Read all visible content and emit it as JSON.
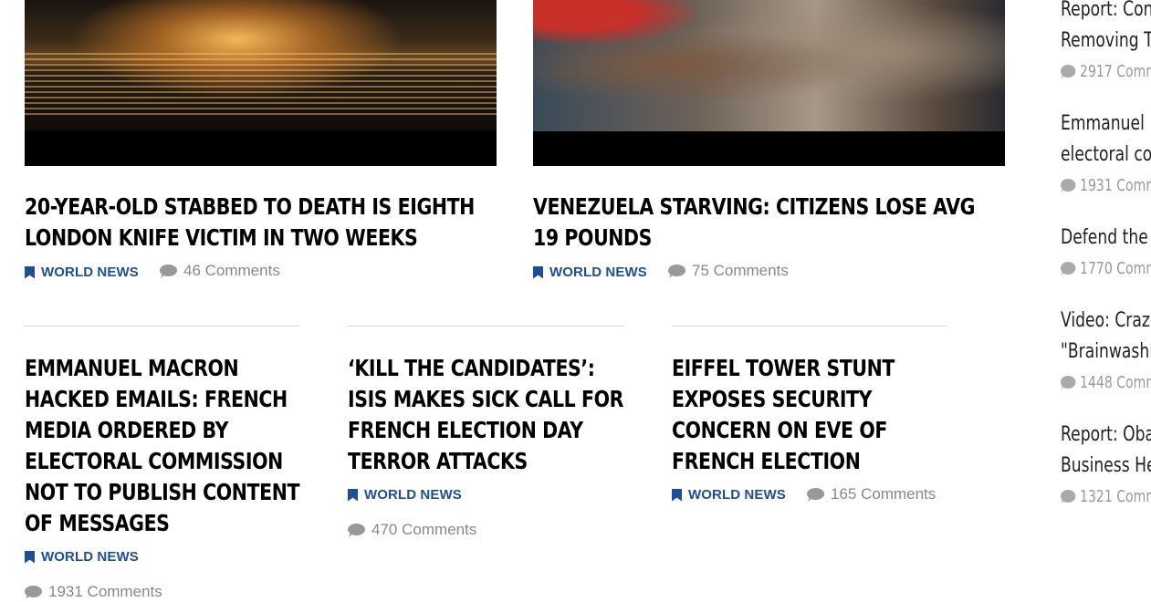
{
  "articles": [
    {
      "headline": "20-Year-Old Stabbed to Death Is Eighth London Knife Victim in Two Weeks",
      "category": "WORLD NEWS",
      "comments": "46 Comments"
    },
    {
      "headline": "Venezuela Starving: Citizens Lose Avg 19 Pounds",
      "category": "WORLD NEWS",
      "comments": "75 Comments"
    },
    {
      "headline": "Emmanuel Macron Hacked Emails: French Media Ordered by Electoral Commission Not to Publish Content of Messages",
      "category": "WORLD NEWS",
      "comments": "1931 Comments"
    },
    {
      "headline": "‘Kill the Candidates’: ISIS Makes Sick Call for French Election Day Terror Attacks",
      "category": "WORLD NEWS",
      "comments": "470 Comments"
    },
    {
      "headline": "Eiffel Tower Stunt Exposes Security Concern on Eve of French Election",
      "category": "WORLD NEWS",
      "comments": "165 Comments"
    }
  ],
  "sidebar": {
    "items": [
      {
        "title_line1": "Report: Con",
        "title_line2": "Removing Tr",
        "comments": "2917 Comm"
      },
      {
        "title_line1": "Emmanuel M",
        "title_line2": "electoral co",
        "comments": "1931 Comm"
      },
      {
        "title_line1": "Defend the V",
        "title_line2": "",
        "comments": "1770 Comm"
      },
      {
        "title_line1": "Video: Craze",
        "title_line2": "\"Brainwashi",
        "comments": "1448 Comm"
      },
      {
        "title_line1": "Report: Oba",
        "title_line2": "Business He",
        "comments": "1321 Comm"
      }
    ]
  },
  "colors": {
    "category": "#1f4e95",
    "comment_text": "#888888",
    "headline": "#000000"
  },
  "icons": {
    "category": "bookmark-icon",
    "comments": "comment-bubble-icon"
  }
}
